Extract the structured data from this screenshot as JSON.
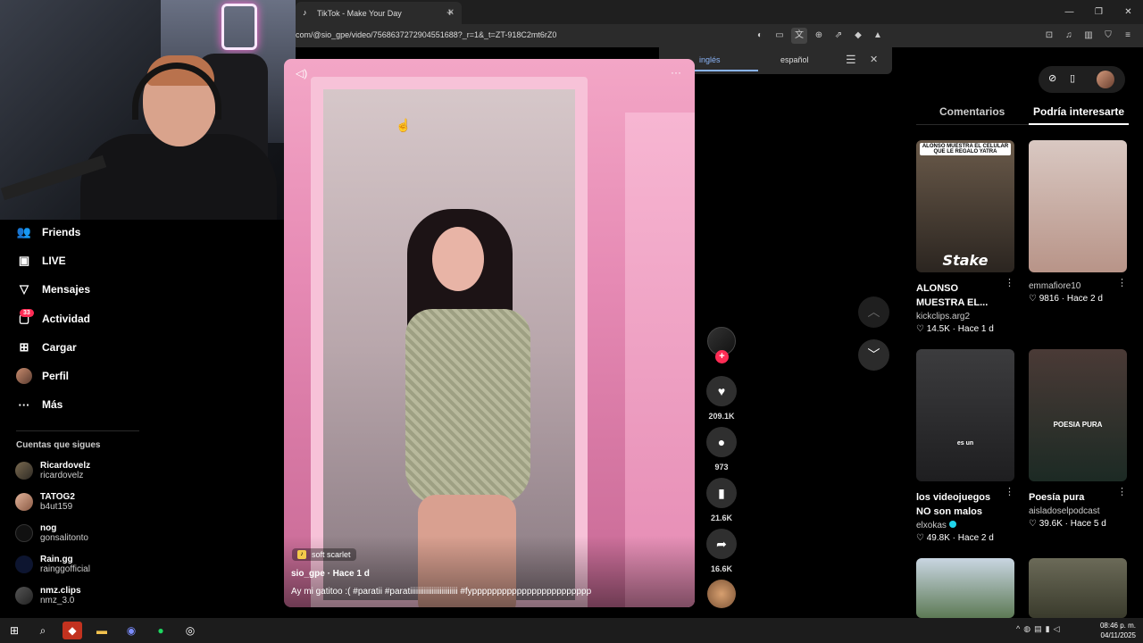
{
  "browser": {
    "tab_title": "TikTok - Make Your Day",
    "tab_close": "✕",
    "new_tab": "+",
    "url": "com/@sio_gpe/video/7568637272904551688?_r=1&_t=ZT-918C2mt6rZ0",
    "window_controls": [
      "—",
      "❐",
      "✕"
    ]
  },
  "translate_popup": {
    "source_lang": "inglés",
    "target_lang": "español"
  },
  "sidebar": {
    "nav": [
      {
        "label": "Friends",
        "icon": "friends-icon"
      },
      {
        "label": "LIVE",
        "icon": "live-icon"
      },
      {
        "label": "Mensajes",
        "icon": "messages-icon"
      },
      {
        "label": "Actividad",
        "icon": "activity-icon",
        "badge": "33"
      },
      {
        "label": "Cargar",
        "icon": "upload-icon"
      },
      {
        "label": "Perfil",
        "icon": "profile-icon"
      },
      {
        "label": "Más",
        "icon": "more-icon"
      }
    ],
    "following_title": "Cuentas que sigues",
    "following": [
      {
        "name": "Ricardovelz",
        "user": "ricardovelz"
      },
      {
        "name": "TATOG2",
        "user": "b4ut159"
      },
      {
        "name": "nog",
        "user": "gonsalitonto"
      },
      {
        "name": "Rain.gg",
        "user": "rainggofficial"
      },
      {
        "name": "nmz.clips",
        "user": "nmz_3.0"
      }
    ]
  },
  "video": {
    "sound": "soft scarlet",
    "author_line": "sio_gpe · Hace 1 d",
    "caption": "Ay mi gatitoo :(  #paratii  #paratiiiiiiiiiiiiiiiiiiiiiiii  #fypppppppppppppppppppppppp"
  },
  "actions": {
    "likes": "209.1K",
    "comments": "973",
    "saves": "21.6K",
    "shares": "16.6K"
  },
  "right_panel": {
    "tabs": [
      "Comentarios",
      "Podría interesarte"
    ],
    "active_tab": "Podría interesarte",
    "cards": [
      {
        "title": "ALONSO MUESTRA EL...",
        "user": "kickclips.arg2",
        "likes": "14.5K",
        "time": "Hace 1 d",
        "thumb_text": "ALONSO MUESTRA EL CELULAR QUE LE REGALO YATRA",
        "brand": "Stake"
      },
      {
        "title": "",
        "user": "emmafiore10",
        "likes": "9816",
        "time": "Hace 2 d"
      },
      {
        "title": "los videojuegos NO son malos",
        "user": "elxokas",
        "likes": "49.8K",
        "time": "Hace 2 d",
        "thumb_text": "es un"
      },
      {
        "title": "Poesía pura",
        "user": "aisladoselpodcast",
        "likes": "39.6K",
        "time": "Hace 5 d",
        "thumb_text": "POESIA PURA"
      }
    ]
  },
  "taskbar": {
    "time": "08:46 p. m.",
    "date": "04/11/2025"
  },
  "colors": {
    "accent": "#fe2c55",
    "link_blue": "#8ab4f8"
  }
}
